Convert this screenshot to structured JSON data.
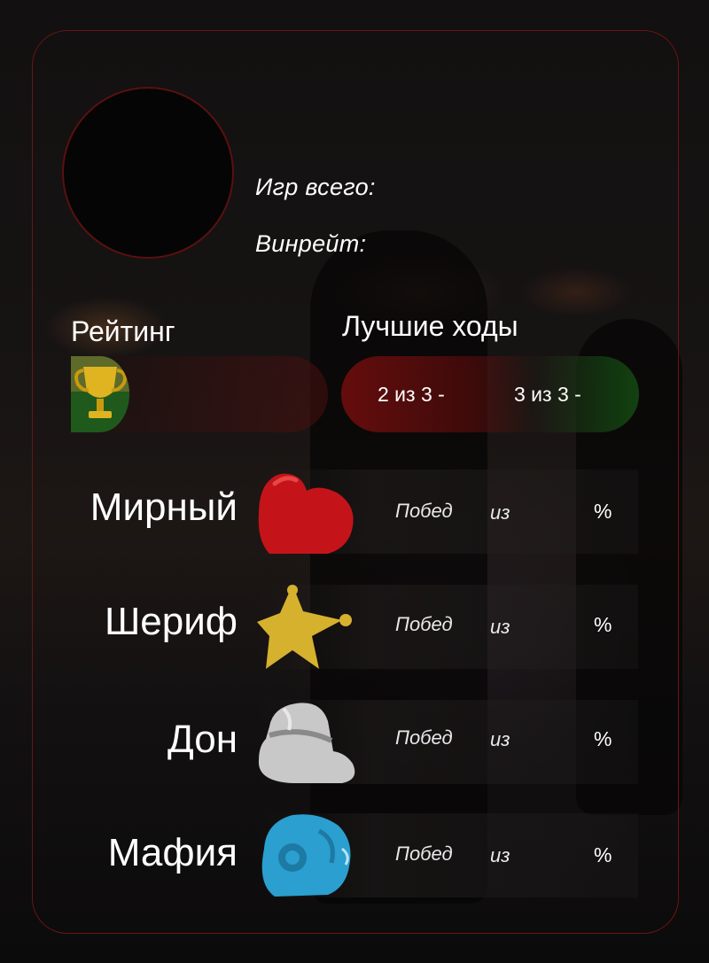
{
  "stats": {
    "games_total_label": "Игр всего:",
    "winrate_label": "Винрейт:"
  },
  "rating": {
    "label": "Рейтинг",
    "icon": "trophy-icon"
  },
  "best_moves": {
    "label": "Лучшие ходы",
    "two_of_three": "2 из 3 -",
    "three_of_three": "3 из 3 -"
  },
  "roles": [
    {
      "name": "Мирный",
      "wins_label": "Побед",
      "of_label": "из",
      "percent_label": "%",
      "icon": "heart-icon",
      "color": "#c4141a"
    },
    {
      "name": "Шериф",
      "wins_label": "Побед",
      "of_label": "из",
      "percent_label": "%",
      "icon": "sheriff-star-icon",
      "color": "#d6b12e"
    },
    {
      "name": "Дон",
      "wins_label": "Побед",
      "of_label": "из",
      "percent_label": "%",
      "icon": "fedora-hat-icon",
      "color": "#c8c8c8"
    },
    {
      "name": "Мафия",
      "wins_label": "Побед",
      "of_label": "из",
      "percent_label": "%",
      "icon": "revolver-icon",
      "color": "#2a9fd0"
    }
  ],
  "colors": {
    "frame": "#6b1414",
    "accent_red": "#8c0e0e",
    "accent_green": "#145a14"
  }
}
